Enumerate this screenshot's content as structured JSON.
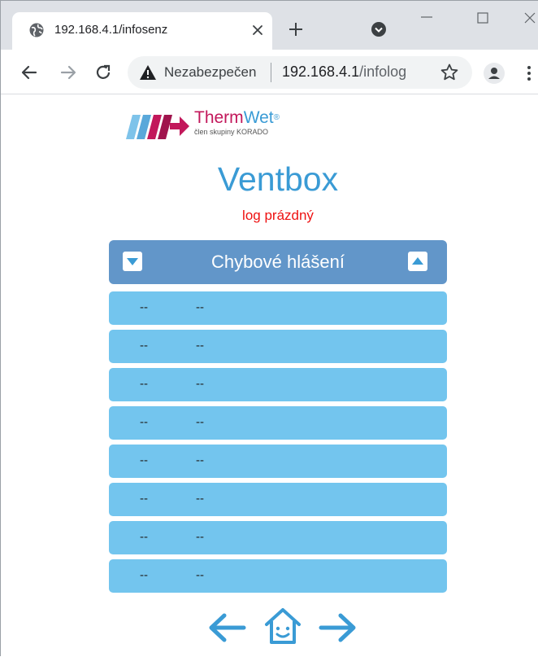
{
  "browser": {
    "tab": {
      "title": "192.168.4.1/infosenz",
      "favicon": "globe-icon"
    },
    "address": {
      "security_label": "Nezabezpečen",
      "host": "192.168.4.1",
      "path": "/infolog"
    }
  },
  "page": {
    "logo": {
      "brand_therm": "Therm",
      "brand_wet": "Wet",
      "reg": "®",
      "subtitle": "člen skupiny KORADO"
    },
    "title": "Ventbox",
    "status": "log prázdný",
    "panel": {
      "title": "Chybové hlášení"
    },
    "log_rows": [
      {
        "col1": "--",
        "col2": "--"
      },
      {
        "col1": "--",
        "col2": "--"
      },
      {
        "col1": "--",
        "col2": "--"
      },
      {
        "col1": "--",
        "col2": "--"
      },
      {
        "col1": "--",
        "col2": "--"
      },
      {
        "col1": "--",
        "col2": "--"
      },
      {
        "col1": "--",
        "col2": "--"
      },
      {
        "col1": "--",
        "col2": "--"
      }
    ]
  },
  "colors": {
    "accent": "#3a9bd5",
    "panel_header": "#6296c9",
    "row_bg": "#73c5ee",
    "status_text": "#ee1111",
    "brand_magenta": "#c2185b"
  }
}
